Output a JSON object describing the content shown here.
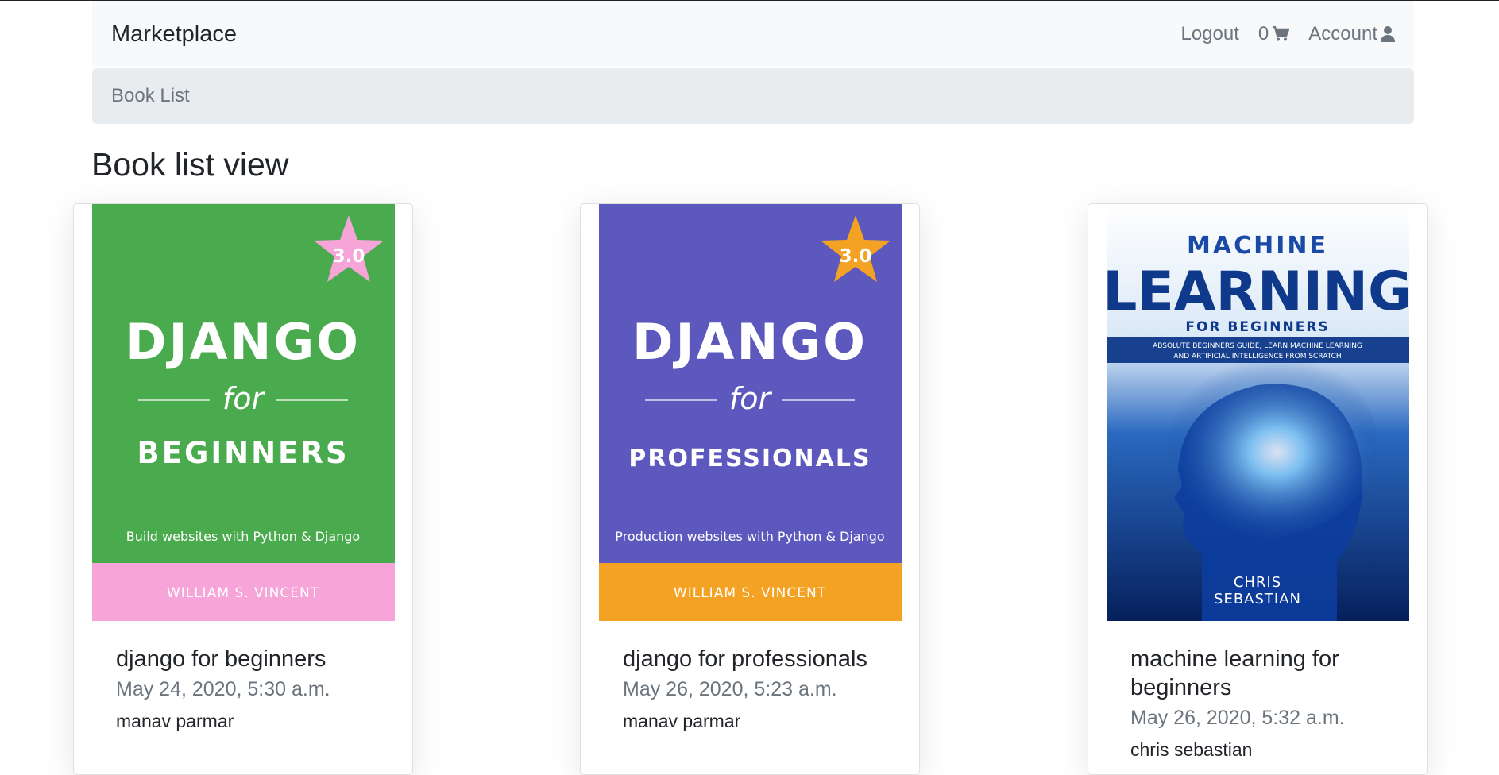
{
  "navbar": {
    "brand": "Marketplace",
    "logout": "Logout",
    "cart_count": "0",
    "account": "Account"
  },
  "breadcrumb": {
    "label": "Book List"
  },
  "page_title": "Book list view",
  "books": [
    {
      "title": "django for beginners",
      "date": "May 24, 2020, 5:30 a.m.",
      "author": "manav parmar",
      "cover": {
        "rating": "3.0",
        "line1": "DJANGO",
        "line2": "for",
        "line3": "BEGINNERS",
        "tagline": "Build websites with Python & Django",
        "author": "WILLIAM S. VINCENT",
        "bg": "#4aaa4e",
        "band": "#f7a5d9",
        "star": "#f7a5d9"
      }
    },
    {
      "title": "django for professionals",
      "date": "May 26, 2020, 5:23 a.m.",
      "author": "manav parmar",
      "cover": {
        "rating": "3.0",
        "line1": "DJANGO",
        "line2": "for",
        "line3": "PROFESSIONALS",
        "tagline": "Production websites with Python & Django",
        "author": "WILLIAM S. VINCENT",
        "bg": "#5c58bd",
        "band": "#f3a223",
        "star": "#f3a223"
      }
    },
    {
      "title": "machine learning for beginners",
      "date": "May 26, 2020, 5:32 a.m.",
      "author": "chris sebastian",
      "cover": {
        "line1": "MACHINE",
        "line2": "LEARNING",
        "line3": "FOR BEGINNERS",
        "subtitle1": "ABSOLUTE BEGINNERS GUIDE, LEARN MACHINE LEARNING",
        "subtitle2": "AND ARTIFICIAL INTELLIGENCE FROM SCRATCH",
        "author1": "CHRIS",
        "author2": "SEBASTIAN"
      }
    }
  ]
}
